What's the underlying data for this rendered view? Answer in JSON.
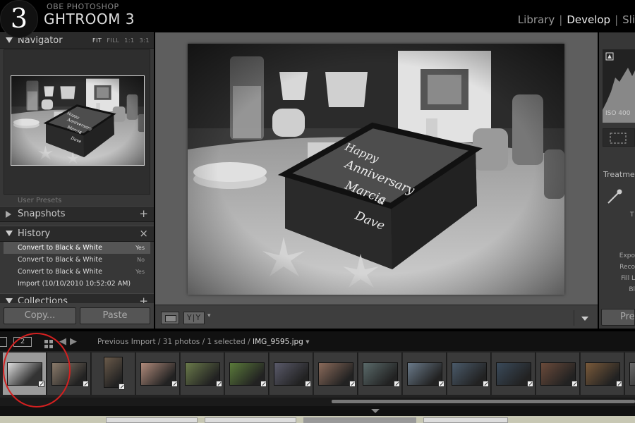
{
  "header": {
    "step_number": "3",
    "brand_top": "OBE PHOTOSHOP",
    "brand_name": "GHTROOM 3",
    "modules": [
      "Library",
      "Develop",
      "Sli"
    ],
    "active_module": "Develop"
  },
  "left_panel": {
    "navigator": {
      "title": "Navigator",
      "zoom_options": [
        "FIT",
        "FILL",
        "1:1",
        "3:1"
      ],
      "selected_zoom": "FIT"
    },
    "user_presets_label": "User Presets",
    "snapshots": {
      "title": "Snapshots",
      "action": "+"
    },
    "history": {
      "title": "History",
      "action": "×",
      "items": [
        {
          "label": "Convert to Black & White",
          "value": "Yes",
          "selected": true
        },
        {
          "label": "Convert to Black & White",
          "value": "No",
          "selected": false
        },
        {
          "label": "Convert to Black & White",
          "value": "Yes",
          "selected": false
        },
        {
          "label": "Import (10/10/2010 10:52:02 AM)",
          "value": "",
          "selected": false
        }
      ]
    },
    "collections": {
      "title": "Collections",
      "action": "+"
    },
    "copy_button": "Copy...",
    "paste_button": "Paste"
  },
  "center": {
    "yy_label": "Y|Y",
    "cake_text": [
      "Happy",
      "Anniversary",
      "Marcia",
      "&",
      "Dave"
    ]
  },
  "right_panel": {
    "iso": "ISO 400",
    "treatment": "Treatme",
    "t_label": "T",
    "labels": [
      "Expo",
      "Reco",
      "Fill L",
      "Bl"
    ],
    "prev_button": "Pre"
  },
  "filmstrip_bar": {
    "screen_label": "2",
    "path": "Previous Import / 31 photos / 1 selected /",
    "filename": "IMG_9595.jpg",
    "dropdown": "▾"
  },
  "filmstrip": {
    "total_photos": 31,
    "selected_index": 0
  },
  "colors": {
    "accent_highlight": "#d42020",
    "panel_bg": "#373737",
    "center_bg": "#5e5e5e"
  }
}
